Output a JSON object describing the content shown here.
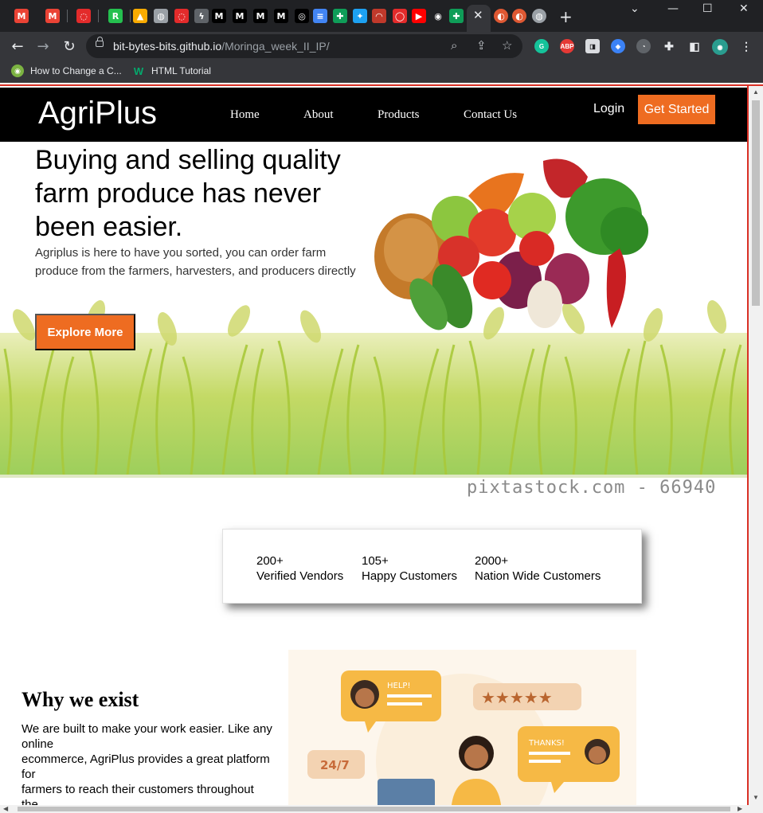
{
  "browser": {
    "tabs": [
      {
        "icon": "gmail-icon",
        "color": "#ea4335",
        "glyph": "M"
      },
      {
        "icon": "gmail-icon",
        "color": "#ea4335",
        "glyph": "M"
      },
      {
        "icon": "opera-icon",
        "color": "#e32b2b",
        "glyph": "◌"
      },
      {
        "icon": "rc-icon",
        "color": "#25c04f",
        "glyph": "R"
      },
      {
        "icon": "google-drive-icon",
        "color": "#f9ab00",
        "glyph": "▲"
      },
      {
        "icon": "globe-icon",
        "color": "#9aa0a6",
        "glyph": "◍"
      },
      {
        "icon": "opera-icon",
        "color": "#e32b2b",
        "glyph": "◌"
      },
      {
        "icon": "bolt-icon",
        "color": "#5f6368",
        "glyph": "ϟ"
      },
      {
        "icon": "m-icon",
        "color": "#000000",
        "glyph": "M"
      },
      {
        "icon": "m-icon",
        "color": "#000000",
        "glyph": "M"
      },
      {
        "icon": "m-icon",
        "color": "#000000",
        "glyph": "M"
      },
      {
        "icon": "m-icon",
        "color": "#000000",
        "glyph": "M"
      },
      {
        "icon": "circle-icon",
        "color": "#000000",
        "glyph": "◎"
      },
      {
        "icon": "docs-icon",
        "color": "#4285f4",
        "glyph": "≡"
      },
      {
        "icon": "plus-green-icon",
        "color": "#0f9d58",
        "glyph": "✚"
      },
      {
        "icon": "twitter-icon",
        "color": "#1da1f2",
        "glyph": "✦"
      },
      {
        "icon": "gauge-icon",
        "color": "#c0392b",
        "glyph": "◠"
      },
      {
        "icon": "oval-icon",
        "color": "#e32b2b",
        "glyph": "◯"
      },
      {
        "icon": "youtube-icon",
        "color": "#ff0000",
        "glyph": "▶"
      },
      {
        "icon": "github-icon",
        "color": "#202124",
        "glyph": "◉"
      },
      {
        "icon": "plus-green-icon",
        "color": "#0f9d58",
        "glyph": "✚"
      }
    ],
    "address": {
      "host": "bit-bytes-bits.github.io",
      "path": "/Moringa_week_II_IP/"
    },
    "bookmarks": [
      {
        "label": "How to Change a C..."
      },
      {
        "label": "HTML Tutorial"
      }
    ]
  },
  "site": {
    "brand": "AgriPlus",
    "nav": [
      "Home",
      "About",
      "Products",
      "Contact Us"
    ],
    "login": "Login",
    "cta": "Get Started"
  },
  "hero": {
    "title": "Buying and selling quality farm produce has never been easier.",
    "text": "Agriplus is here to have you sorted, you can order farm produce from the farmers, harvesters, and producers directly",
    "button": "Explore More",
    "watermark": "pixtastock.com - 66940"
  },
  "stats": [
    {
      "value": "200+",
      "label": "Verified Vendors"
    },
    {
      "value": "105+",
      "label": "Happy Customers"
    },
    {
      "value": "2000+",
      "label": "Nation Wide Customers"
    }
  ],
  "why": {
    "title": "Why we exist",
    "lines": [
      "We are built to make your work easier. Like any",
      "online",
      "ecommerce, AgriPlus provides a great platform",
      "for",
      "farmers to reach their customers throughout",
      "the"
    ]
  },
  "illustration": {
    "bubble_help": "HELP!",
    "bubble_thanks": "THANKS!",
    "badge": "24/7"
  },
  "colors": {
    "accent": "#ee6c21",
    "header": "#000000"
  }
}
